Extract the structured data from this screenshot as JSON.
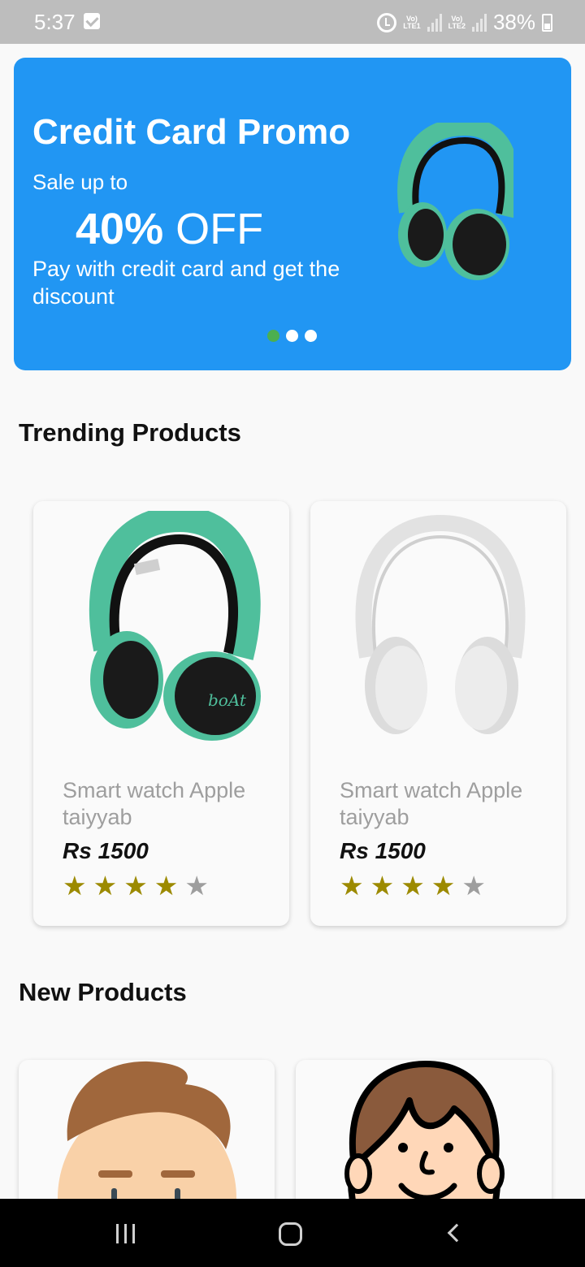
{
  "status_bar": {
    "time": "5:37",
    "sim1": "LTE1",
    "sim2": "LTE2",
    "battery": "38%",
    "icons": [
      "check-icon",
      "alarm-icon",
      "signal-icon",
      "battery-icon"
    ]
  },
  "promo": {
    "title": "Credit Card Promo",
    "sale": "Sale up to",
    "off_number": "40%",
    "off_text": "OFF",
    "description": "Pay with credit card and get the discount",
    "slide_count": 3,
    "active_slide": 0,
    "colors": {
      "background": "#2196f3",
      "active_dot": "#4caf50"
    }
  },
  "trending": {
    "title": "Trending Products",
    "products": [
      {
        "name": "Smart watch Apple taiyyab",
        "price": "Rs 1500",
        "rating": 4,
        "max_rating": 5,
        "image": "green-headphones-image"
      },
      {
        "name": "Smart watch Apple taiyyab",
        "price": "Rs 1500",
        "rating": 4,
        "max_rating": 5,
        "image": "white-headphones-image"
      }
    ]
  },
  "new_products": {
    "title": "New Products",
    "products": [
      {
        "image": "boy-avatar-image"
      },
      {
        "image": "cartoon-boy-avatar-image"
      }
    ]
  },
  "colors": {
    "star": "#9c8a00",
    "star_empty": "#9e9e9e",
    "name_text": "#9e9e9e"
  }
}
